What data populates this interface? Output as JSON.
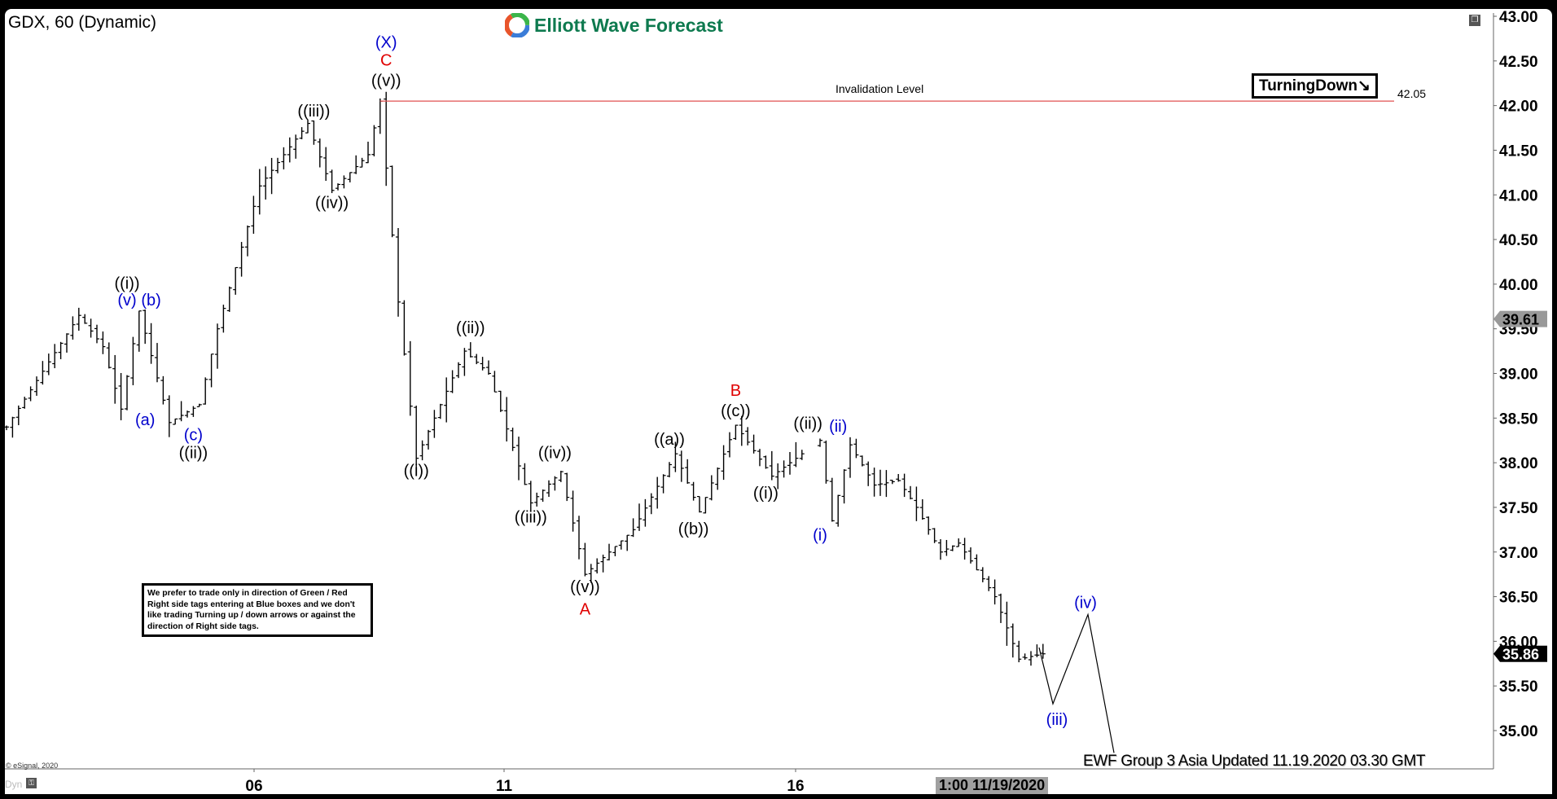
{
  "header": {
    "title": "GDX, 60 (Dynamic)",
    "logo_text": "Elliott Wave Forecast"
  },
  "annotations": {
    "invalidation_label": "Invalidation Level",
    "invalidation_value": "42.05",
    "turning_down": "TurningDown↘",
    "disclaimer": "We prefer to trade only in direction of Green / Red Right side tags entering at Blue boxes and we don't like trading Turning up / down arrows or against the direction of Right side tags.",
    "ewf_note": "EWF Group 3  Asia Updated 11.19.2020 03.30 GMT",
    "copyright": "© eSignal, 2020",
    "dyn_label": "Dyn",
    "lock_icon": "lock-icon",
    "restore_icon": "window-restore-icon",
    "crosshair_time": "1:00 11/19/2020"
  },
  "colors": {
    "black_labels": "#000000",
    "blue_labels": "#0000cc",
    "red_labels": "#e00000",
    "invalidation_line": "#e05050",
    "brand_green": "#0e7a4f"
  },
  "chart_data": {
    "type": "ohlc",
    "title": "GDX, 60 (Dynamic)",
    "ylim": [
      34.7,
      43.05
    ],
    "yticks": [
      "43.00",
      "42.50",
      "42.00",
      "41.50",
      "41.00",
      "40.50",
      "40.00",
      "39.50",
      "39.00",
      "38.50",
      "38.00",
      "37.50",
      "37.00",
      "36.50",
      "36.00",
      "35.50",
      "35.00"
    ],
    "xticks": [
      "06",
      "11",
      "16"
    ],
    "price_tags": [
      {
        "value": "39.61",
        "style": "gray"
      },
      {
        "value": "35.86",
        "style": "black"
      }
    ],
    "invalidation_level": 42.05,
    "path_swings": [
      {
        "bar": 0,
        "price": 38.4
      },
      {
        "bar": 12,
        "price": 39.65
      },
      {
        "bar": 16,
        "price": 39.3
      },
      {
        "bar": 19,
        "price": 38.6
      },
      {
        "bar": 22,
        "price": 39.7
      },
      {
        "bar": 27,
        "price": 38.45
      },
      {
        "bar": 32,
        "price": 38.65
      },
      {
        "bar": 35,
        "price": 39.5
      },
      {
        "bar": 42,
        "price": 41.1
      },
      {
        "bar": 50,
        "price": 41.8
      },
      {
        "bar": 54,
        "price": 41.05
      },
      {
        "bar": 60,
        "price": 41.45
      },
      {
        "bar": 62,
        "price": 42.05
      },
      {
        "bar": 65,
        "price": 39.8
      },
      {
        "bar": 68,
        "price": 38.05
      },
      {
        "bar": 76,
        "price": 39.25
      },
      {
        "bar": 80,
        "price": 39.0
      },
      {
        "bar": 87,
        "price": 37.55
      },
      {
        "bar": 92,
        "price": 37.9
      },
      {
        "bar": 96,
        "price": 36.75
      },
      {
        "bar": 104,
        "price": 37.25
      },
      {
        "bar": 111,
        "price": 38.1
      },
      {
        "bar": 115,
        "price": 37.45
      },
      {
        "bar": 121,
        "price": 38.42
      },
      {
        "bar": 127,
        "price": 37.85
      },
      {
        "bar": 132,
        "price": 38.1
      },
      {
        "bar": 135,
        "price": 38.25
      },
      {
        "bar": 137,
        "price": 37.35
      },
      {
        "bar": 140,
        "price": 38.2
      },
      {
        "bar": 144,
        "price": 37.75
      },
      {
        "bar": 148,
        "price": 37.8
      },
      {
        "bar": 151,
        "price": 37.5
      },
      {
        "bar": 155,
        "price": 37.0
      },
      {
        "bar": 158,
        "price": 37.1
      },
      {
        "bar": 164,
        "price": 36.5
      },
      {
        "bar": 168,
        "price": 35.8
      },
      {
        "bar": 172,
        "price": 35.86
      }
    ],
    "projection": [
      {
        "label": "start",
        "price": 35.93
      },
      {
        "label": "(iii)",
        "price": 35.3
      },
      {
        "label": "(iv)",
        "price": 36.3
      },
      {
        "label": "end",
        "price": 34.75
      }
    ],
    "wave_labels": [
      {
        "text": "((i))",
        "bar": 20,
        "price": 39.95,
        "color": "black"
      },
      {
        "text": "(v)",
        "bar": 20,
        "price": 39.76,
        "color": "blue"
      },
      {
        "text": "(b)",
        "bar": 24,
        "price": 39.76,
        "color": "blue"
      },
      {
        "text": "(a)",
        "bar": 23,
        "price": 38.42,
        "color": "blue"
      },
      {
        "text": "(c)",
        "bar": 31,
        "price": 38.25,
        "color": "blue"
      },
      {
        "text": "((ii))",
        "bar": 31,
        "price": 38.05,
        "color": "black"
      },
      {
        "text": "((iii))",
        "bar": 51,
        "price": 41.88,
        "color": "black"
      },
      {
        "text": "((iv))",
        "bar": 54,
        "price": 40.85,
        "color": "black"
      },
      {
        "text": "(X)",
        "bar": 63,
        "price": 42.65,
        "color": "blue"
      },
      {
        "text": "C",
        "bar": 63,
        "price": 42.45,
        "color": "red"
      },
      {
        "text": "((v))",
        "bar": 63,
        "price": 42.22,
        "color": "black"
      },
      {
        "text": "((i))",
        "bar": 68,
        "price": 37.85,
        "color": "black"
      },
      {
        "text": "((ii))",
        "bar": 77,
        "price": 39.45,
        "color": "black"
      },
      {
        "text": "((iii))",
        "bar": 87,
        "price": 37.33,
        "color": "black"
      },
      {
        "text": "((iv))",
        "bar": 91,
        "price": 38.05,
        "color": "black"
      },
      {
        "text": "((v))",
        "bar": 96,
        "price": 36.55,
        "color": "black"
      },
      {
        "text": "A",
        "bar": 96,
        "price": 36.3,
        "color": "red"
      },
      {
        "text": "((a))",
        "bar": 110,
        "price": 38.2,
        "color": "black"
      },
      {
        "text": "((b))",
        "bar": 114,
        "price": 37.2,
        "color": "black"
      },
      {
        "text": "B",
        "bar": 121,
        "price": 38.75,
        "color": "red"
      },
      {
        "text": "((c))",
        "bar": 121,
        "price": 38.52,
        "color": "black"
      },
      {
        "text": "((i))",
        "bar": 126,
        "price": 37.6,
        "color": "black"
      },
      {
        "text": "((ii))",
        "bar": 133,
        "price": 38.38,
        "color": "black"
      },
      {
        "text": "(ii)",
        "bar": 138,
        "price": 38.35,
        "color": "blue"
      },
      {
        "text": "(i)",
        "bar": 135,
        "price": 37.13,
        "color": "blue"
      },
      {
        "text": "(iii)",
        "label_at": "projection",
        "color": "blue"
      },
      {
        "text": "(iv)",
        "label_at": "projection",
        "color": "blue"
      }
    ]
  }
}
